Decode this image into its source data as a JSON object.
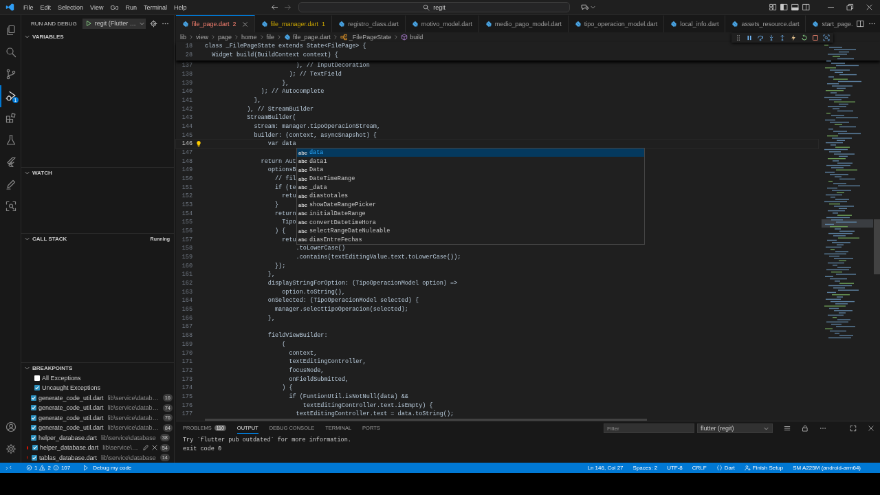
{
  "title_bar": {
    "menu": [
      "File",
      "Edit",
      "Selection",
      "View",
      "Go",
      "Run",
      "Terminal",
      "Help"
    ],
    "search": {
      "value": "regit"
    }
  },
  "activity_bar": {
    "items": [
      {
        "kind": "explorer",
        "selected": false
      },
      {
        "kind": "search",
        "selected": false
      },
      {
        "kind": "scm",
        "selected": false
      },
      {
        "kind": "debug",
        "selected": true,
        "badge": "1"
      },
      {
        "kind": "extensions",
        "selected": false
      },
      {
        "kind": "testing",
        "selected": false
      },
      {
        "kind": "flutter",
        "selected": false
      },
      {
        "kind": "pen",
        "selected": false
      },
      {
        "kind": "scan",
        "selected": false
      }
    ],
    "bottom": [
      {
        "kind": "account",
        "selected": false
      },
      {
        "kind": "settings",
        "selected": false
      }
    ]
  },
  "sidebar": {
    "title": "RUN AND DEBUG",
    "config": "regit (Flutter …",
    "sections": [
      {
        "title": "VARIABLES",
        "expanded": true
      },
      {
        "title": "WATCH",
        "expanded": true
      },
      {
        "title": "CALL STACK",
        "expanded": true,
        "status": "Running"
      },
      {
        "title": "BREAKPOINTS",
        "expanded": true,
        "items": [
          {
            "kind": "exception",
            "label": "All Exceptions",
            "checked": false
          },
          {
            "kind": "exception",
            "label": "Uncaught Exceptions",
            "checked": true
          },
          {
            "kind": "file",
            "label": "generate_code_util.dart",
            "path": "lib\\service\\datab…",
            "count": "16",
            "checked": true,
            "hovered": false
          },
          {
            "kind": "file",
            "label": "generate_code_util.dart",
            "path": "lib\\service\\datab…",
            "count": "74",
            "checked": true,
            "hovered": false
          },
          {
            "kind": "file",
            "label": "generate_code_util.dart",
            "path": "lib\\service\\datab…",
            "count": "76",
            "checked": true,
            "hovered": false
          },
          {
            "kind": "file",
            "label": "generate_code_util.dart",
            "path": "lib\\service\\datab…",
            "count": "84",
            "checked": true,
            "hovered": false
          },
          {
            "kind": "file",
            "label": "helper_database.dart",
            "path": "lib\\service\\database",
            "count": "38",
            "checked": true,
            "hovered": false
          },
          {
            "kind": "file",
            "label": "helper_database.dart",
            "path": "lib\\service\\…",
            "count": "54",
            "checked": true,
            "hovered": true
          },
          {
            "kind": "file",
            "label": "tablas_database.dart",
            "path": "lib\\service\\database",
            "count": "14",
            "checked": true,
            "hovered": false
          }
        ]
      }
    ]
  },
  "editor": {
    "tabs": [
      {
        "label": "file_page.dart",
        "badge": "2",
        "kind": "error",
        "selected": true
      },
      {
        "label": "file_manager.dart",
        "badge": "1",
        "kind": "warning",
        "selected": false
      },
      {
        "label": "registro_class.dart",
        "kind": "normal",
        "selected": false
      },
      {
        "label": "motivo_model.dart",
        "kind": "normal",
        "selected": false
      },
      {
        "label": "medio_pago_model.dart",
        "kind": "normal",
        "selected": false
      },
      {
        "label": "tipo_operacion_model.dart",
        "kind": "normal",
        "selected": false
      },
      {
        "label": "local_info.dart",
        "kind": "normal",
        "selected": false
      },
      {
        "label": "assets_resource.dart",
        "kind": "normal",
        "selected": false
      },
      {
        "label": "start_page.",
        "kind": "normal",
        "selected": false
      }
    ],
    "breadcrumb": [
      {
        "label": "lib",
        "kind": "folder"
      },
      {
        "label": "view",
        "kind": "folder"
      },
      {
        "label": "page",
        "kind": "folder"
      },
      {
        "label": "home",
        "kind": "folder"
      },
      {
        "label": "file",
        "kind": "folder"
      },
      {
        "label": "file_page.dart",
        "kind": "dart"
      },
      {
        "label": "_FilePageState",
        "kind": "class"
      },
      {
        "label": "build",
        "kind": "method"
      }
    ],
    "sticky_lines": [
      {
        "number": "18",
        "text": "class _FilePageState extends State<FilePage> {"
      },
      {
        "number": "28",
        "text": "  Widget build(BuildContext context) {"
      }
    ],
    "lines": [
      {
        "number": "137",
        "text": "                          ), // InputDecoration",
        "current": false
      },
      {
        "number": "138",
        "text": "                        ); // TextField",
        "current": false
      },
      {
        "number": "139",
        "text": "                      },",
        "current": false
      },
      {
        "number": "140",
        "text": "                ); // Autocomplete",
        "current": false
      },
      {
        "number": "141",
        "text": "              },",
        "current": false
      },
      {
        "number": "142",
        "text": "            ), // StreamBuilder",
        "current": false
      },
      {
        "number": "143",
        "text": "            StreamBuilder(",
        "current": false
      },
      {
        "number": "144",
        "text": "              stream: manager.tipoOperacionStream,",
        "current": false
      },
      {
        "number": "145",
        "text": "              builder: (context, asyncSnapshot) {",
        "current": false
      },
      {
        "number": "146",
        "text": "                  var data",
        "current": true
      },
      {
        "number": "147",
        "current": false
      },
      {
        "number": "148",
        "text": "                return Aut",
        "current": false
      },
      {
        "number": "149",
        "text": "                  optionsB",
        "current": false
      },
      {
        "number": "150",
        "text": "                    // fil",
        "current": false
      },
      {
        "number": "151",
        "text": "                    if (te",
        "current": false
      },
      {
        "number": "152",
        "text": "                      retu",
        "current": false
      },
      {
        "number": "153",
        "text": "                    }",
        "current": false
      },
      {
        "number": "154",
        "text": "                    return",
        "current": false
      },
      {
        "number": "155",
        "text": "                      Tipo",
        "current": false
      },
      {
        "number": "156",
        "text": "                    ) {",
        "current": false
      },
      {
        "number": "157",
        "text": "                      retu",
        "current": false
      },
      {
        "number": "158",
        "text": "                          .toLowerCase()",
        "current": false
      },
      {
        "number": "159",
        "text": "                          .contains(textEditingValue.text.toLowerCase());",
        "current": false
      },
      {
        "number": "160",
        "text": "                    });",
        "current": false
      },
      {
        "number": "161",
        "text": "                  },",
        "current": false
      },
      {
        "number": "162",
        "text": "                  displayStringForOption: (TipoOperacionModel option) =>",
        "current": false
      },
      {
        "number": "163",
        "text": "                      option.toString(),",
        "current": false
      },
      {
        "number": "164",
        "text": "                  onSelected: (TipoOperacionModel selected) {",
        "current": false
      },
      {
        "number": "165",
        "text": "                    manager.selecttipoOperacion(selected);",
        "current": false
      },
      {
        "number": "166",
        "text": "                  },",
        "current": false
      },
      {
        "number": "167",
        "current": false
      },
      {
        "number": "168",
        "text": "                  fieldViewBuilder:",
        "current": false
      },
      {
        "number": "169",
        "text": "                      (",
        "current": false
      },
      {
        "number": "170",
        "text": "                        context,",
        "current": false
      },
      {
        "number": "171",
        "text": "                        textEditingController,",
        "current": false
      },
      {
        "number": "172",
        "text": "                        focusNode,",
        "current": false
      },
      {
        "number": "173",
        "text": "                        onFieldSubmitted,",
        "current": false
      },
      {
        "number": "174",
        "text": "                      ) {",
        "current": false
      },
      {
        "number": "175",
        "text": "                        if (FuntionUtil.isNotNull(data) &&",
        "current": false
      },
      {
        "number": "176",
        "text": "                            textEditingController.text.isEmpty) {",
        "current": false
      },
      {
        "number": "177",
        "text": "                          textEditingController.text = data.toString();",
        "current": false
      }
    ],
    "suggestions": [
      {
        "icon": "abc",
        "label": "data",
        "selected": true
      },
      {
        "icon": "abc",
        "label": "data1",
        "selected": false
      },
      {
        "icon": "abc",
        "label": "Data",
        "selected": false
      },
      {
        "icon": "abc",
        "label": "DateTimeRange",
        "selected": false
      },
      {
        "icon": "abc",
        "label": "_data",
        "selected": false
      },
      {
        "icon": "abc",
        "label": "diastotales",
        "selected": false
      },
      {
        "icon": "abc",
        "label": "showDateRangePicker",
        "selected": false
      },
      {
        "icon": "abc",
        "label": "initialDateRange",
        "selected": false
      },
      {
        "icon": "abc",
        "label": "convertDatetimeHora",
        "selected": false
      },
      {
        "icon": "abc",
        "label": "selectRangeDateNuleable",
        "selected": false
      },
      {
        "icon": "abc",
        "label": "diasEntreFechas",
        "selected": false
      }
    ]
  },
  "panel": {
    "tabs": [
      {
        "label": "PROBLEMS",
        "badge": "110",
        "selected": false
      },
      {
        "label": "OUTPUT",
        "selected": true
      },
      {
        "label": "DEBUG CONSOLE",
        "selected": false
      },
      {
        "label": "TERMINAL",
        "selected": false
      },
      {
        "label": "PORTS",
        "selected": false
      }
    ],
    "filter": {
      "placeholder": "Filter"
    },
    "channel": "flutter (regit)",
    "output": [
      "Try `flutter pub outdated` for more information.",
      "exit code 0"
    ]
  },
  "status_bar": {
    "errors": "1",
    "warnings": "2",
    "infos": "107",
    "debug": "Debug my code",
    "items": [
      {
        "label": "Ln 146, Col 27",
        "kind": "text"
      },
      {
        "label": "Spaces: 2",
        "kind": "text"
      },
      {
        "label": "UTF-8",
        "kind": "text"
      },
      {
        "label": "CRLF",
        "kind": "text"
      },
      {
        "label": "Dart",
        "kind": "language"
      },
      {
        "label": "Finish Setup",
        "kind": "setup"
      },
      {
        "label": "SM A225M (android-arm64)",
        "kind": "text"
      }
    ]
  }
}
